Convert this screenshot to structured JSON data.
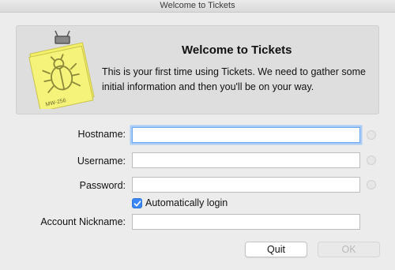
{
  "window": {
    "title": "Welcome to Tickets"
  },
  "header": {
    "title": "Welcome to Tickets",
    "body": "This is your first time using Tickets.  We need to gather some initial information and then you'll be on your way.",
    "icon": "ticket-note-bug-icon",
    "icon_label": "MW-256"
  },
  "form": {
    "hostname_label": "Hostname:",
    "hostname_value": "",
    "username_label": "Username:",
    "username_value": "",
    "password_label": "Password:",
    "password_value": "",
    "auto_login_label": "Automatically login",
    "auto_login_checked": true,
    "nickname_label": "Account Nickname:",
    "nickname_value": ""
  },
  "buttons": {
    "quit": "Quit",
    "ok": "OK"
  },
  "colors": {
    "accent": "#3a86f5",
    "focus_ring": "#a9cbf5",
    "note_yellow": "#f3f06a"
  }
}
